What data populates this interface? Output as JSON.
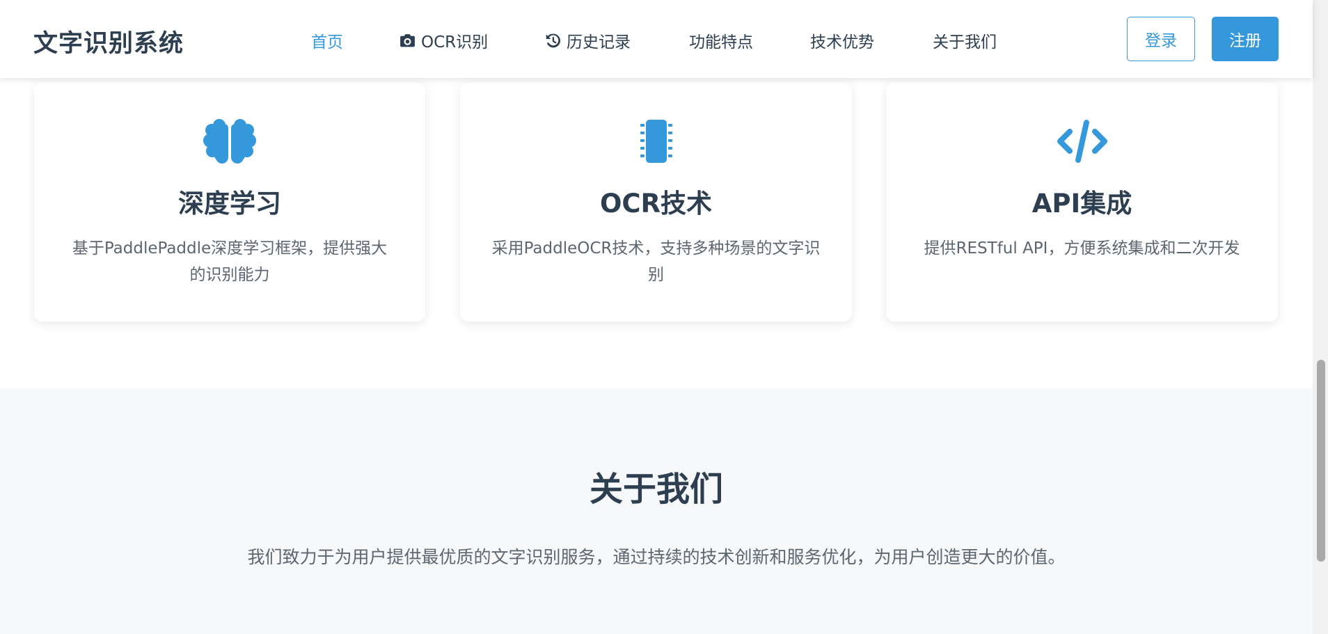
{
  "header": {
    "brand": "文字识别系统",
    "nav": [
      {
        "label": "首页",
        "icon": ""
      },
      {
        "label": "OCR识别",
        "icon": "camera-icon"
      },
      {
        "label": "历史记录",
        "icon": "history-icon"
      },
      {
        "label": "功能特点",
        "icon": ""
      },
      {
        "label": "技术优势",
        "icon": ""
      },
      {
        "label": "关于我们",
        "icon": ""
      }
    ],
    "login_label": "登录",
    "register_label": "注册"
  },
  "features": [
    {
      "icon": "brain-icon",
      "title": "深度学习",
      "desc": "基于PaddlePaddle深度学习框架，提供强大的识别能力"
    },
    {
      "icon": "microchip-icon",
      "title": "OCR技术",
      "desc": "采用PaddleOCR技术，支持多种场景的文字识别"
    },
    {
      "icon": "code-icon",
      "title": "API集成",
      "desc": "提供RESTful API，方便系统集成和二次开发"
    }
  ],
  "about": {
    "title": "关于我们",
    "text": "我们致力于为用户提供最优质的文字识别服务，通过持续的技术创新和服务优化，为用户创造更大的价值。"
  },
  "colors": {
    "accent": "#3498db",
    "text_dark": "#2c3e50",
    "text_muted": "#5c6670",
    "section_bg": "#f7f8fa"
  }
}
